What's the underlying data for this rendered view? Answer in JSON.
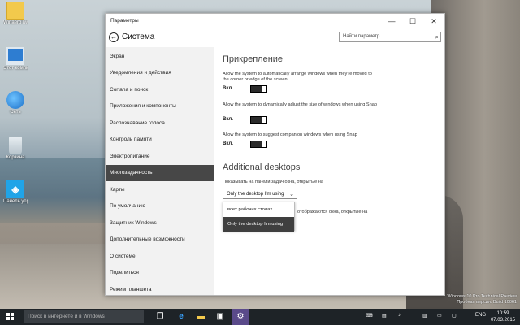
{
  "desktop": {
    "icons": [
      {
        "label": "WinaeroTweaker",
        "icon": "folder-icon"
      },
      {
        "label": "Этот компьютер",
        "icon": "computer-icon"
      },
      {
        "label": "Сеть",
        "icon": "network-icon"
      },
      {
        "label": "Корзина",
        "icon": "recycle-bin-icon"
      },
      {
        "label": "Панель управления",
        "icon": "control-panel-icon"
      }
    ],
    "watermark": [
      "Windows 10 Pro Technical Preview",
      "Пробная версия. Build 10061"
    ]
  },
  "window": {
    "title": "Параметры",
    "controls": {
      "minimize": "—",
      "maximize": "☐",
      "close": "✕"
    },
    "header_title": "Система",
    "back_glyph": "←",
    "search_placeholder": "Найти параметр",
    "search_glyph": "⌕"
  },
  "sidebar": {
    "items": [
      {
        "label": "Экран",
        "active": false
      },
      {
        "label": "Уведомления и действия",
        "active": false
      },
      {
        "label": "Cortana и поиск",
        "active": false
      },
      {
        "label": "Приложения и компоненты",
        "active": false
      },
      {
        "label": "Распознавание голоса",
        "active": false
      },
      {
        "label": "Контроль памяти",
        "active": false
      },
      {
        "label": "Электропитание",
        "active": false
      },
      {
        "label": "Многозадачность",
        "active": true
      },
      {
        "label": "Карты",
        "active": false
      },
      {
        "label": "По умолчанию",
        "active": false
      },
      {
        "label": "Защитник Windows",
        "active": false
      },
      {
        "label": "Дополнительные возможности",
        "active": false
      },
      {
        "label": "О системе",
        "active": false
      },
      {
        "label": "Поделиться",
        "active": false
      },
      {
        "label": "Режим планшета",
        "active": false
      }
    ]
  },
  "content": {
    "snap_heading": "Прикрепление",
    "settings": [
      {
        "desc": "Allow the system to automatically arrange windows when they're moved to the corner or edge of the screen",
        "state_label": "Вкл.",
        "on": true
      },
      {
        "desc": "Allow the system to dynamically adjust the size of windows when using Snap",
        "state_label": "Вкл.",
        "on": true
      },
      {
        "desc": "Allow the system to suggest companion windows when using Snap",
        "state_label": "Вкл.",
        "on": true
      }
    ],
    "desktops_heading": "Additional desktops",
    "taskbar_desc": "Показывать на панели задач окна, открытые на",
    "select_value": "Only the desktop I'm using",
    "select_arrow": "⌄",
    "dropdown_options": [
      {
        "label": "всех рабочих столах",
        "selected": false
      },
      {
        "label": "Only the desktop I'm using",
        "selected": true
      }
    ],
    "hidden_desc_fragment": "отображаются окна, открытые на"
  },
  "taskbar": {
    "search_placeholder": "Поиск в интернете и в Windows",
    "apps": [
      {
        "icon": "task-view-icon",
        "glyph": "❐"
      },
      {
        "icon": "edge-icon",
        "glyph": "e"
      },
      {
        "icon": "file-explorer-icon",
        "glyph": "▬"
      },
      {
        "icon": "store-icon",
        "glyph": "▣"
      },
      {
        "icon": "settings-icon",
        "glyph": "⚙"
      }
    ],
    "language": "ENG",
    "time": "10:59",
    "date": "07.03.2015"
  }
}
